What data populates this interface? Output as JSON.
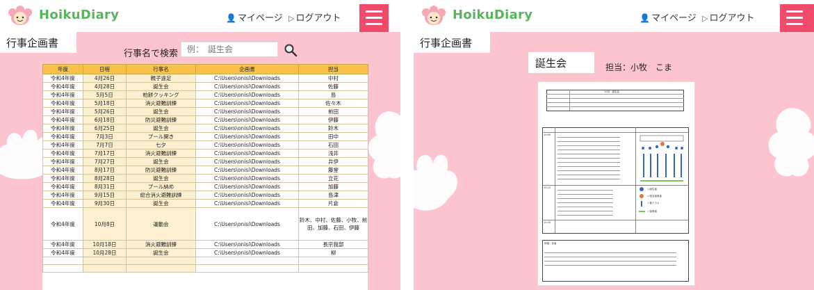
{
  "app": {
    "brand": "HoikuDiary",
    "mypage": "マイページ",
    "logout": "ログアウト"
  },
  "left": {
    "page_title": "行事企画書",
    "search": {
      "label": "行事名で検索",
      "placeholder": "例：　誕生会"
    },
    "table": {
      "headers": [
        "年度",
        "日程",
        "行事名",
        "企画書",
        "担当"
      ],
      "rows": [
        [
          "令和4年度",
          "4月26日",
          "親子遠足",
          "C:\\Users\\onisi\\Downloads",
          "中村"
        ],
        [
          "令和4年度",
          "4月28日",
          "誕生会",
          "C:\\Users\\onisi\\Downloads",
          "佐藤"
        ],
        [
          "令和4年度",
          "5月5日",
          "柏餅クッキング",
          "C:\\Users\\onisi\\Downloads",
          "島"
        ],
        [
          "令和4年度",
          "5月18日",
          "消火避難訓練",
          "C:\\Users\\onisi\\Downloads",
          "佐々木"
        ],
        [
          "令和4年度",
          "5月26日",
          "誕生会",
          "C:\\Users\\onisi\\Downloads",
          "前田"
        ],
        [
          "令和4年度",
          "6月18日",
          "防災避難訓練",
          "C:\\Users\\onisi\\Downloads",
          "伊藤"
        ],
        [
          "令和4年度",
          "6月25日",
          "誕生会",
          "C:\\Users\\onisi\\Downloads",
          "鈴木"
        ],
        [
          "令和4年度",
          "7月3日",
          "プール開き",
          "C:\\Users\\onisi\\Downloads",
          "田中"
        ],
        [
          "令和4年度",
          "7月7日",
          "七夕",
          "C:\\Users\\onisi\\Downloads",
          "石田"
        ],
        [
          "令和4年度",
          "7月17日",
          "消火避難訓練",
          "C:\\Users\\onisi\\Downloads",
          "浅井"
        ],
        [
          "令和4年度",
          "7月27日",
          "誕生会",
          "C:\\Users\\onisi\\Downloads",
          "井伊"
        ],
        [
          "令和4年度",
          "8月17日",
          "防災避難訓練",
          "C:\\Users\\onisi\\Downloads",
          "藤堂"
        ],
        [
          "令和4年度",
          "8月28日",
          "誕生会",
          "C:\\Users\\onisi\\Downloads",
          "立花"
        ],
        [
          "令和4年度",
          "8月31日",
          "プール納め",
          "C:\\Users\\onisi\\Downloads",
          "加藤"
        ],
        [
          "令和4年度",
          "9月15日",
          "総合消火避難訓練",
          "C:\\Users\\onisi\\Downloads",
          "島津"
        ],
        [
          "令和4年度",
          "9月30日",
          "誕生会",
          "C:\\Users\\onisi\\Downloads",
          "片倉"
        ]
      ],
      "tall_row": [
        "令和4年度",
        "10月8日",
        "運動会",
        "C:\\Users\\onisi\\Downloads",
        "鈴木、中村、佐藤、小牧、前田、加藤、石田、伊藤"
      ],
      "rows_after": [
        [
          "令和4年度",
          "10月18日",
          "消火避難訓練",
          "C:\\Users\\onisi\\Downloads",
          "長宗我部"
        ],
        [
          "令和4年度",
          "10月28日",
          "誕生会",
          "C:\\Users\\onisi\\Downloads",
          "柳"
        ]
      ]
    }
  },
  "right": {
    "page_title": "行事企画書",
    "doc_title": "誕生会",
    "doc_owner": "担当：小牧　こま",
    "paper": {
      "header_line": "10月　誕生会",
      "time_1": "10:00",
      "time_2": "10:15",
      "time_3": "10:30",
      "legend_1": "＝誕生者",
      "legend_2": "＝担当保育者",
      "legend_3": "＝各クラス",
      "legend_4": "＝保育者",
      "section_label": "評価・反省"
    }
  },
  "colors": {
    "pink": "#fbc4cf",
    "menu_red": "#f04b6a",
    "brand_green": "#58b55e",
    "header_yellow": "#f7c14a",
    "cell_cream": "#fdf0d0"
  }
}
